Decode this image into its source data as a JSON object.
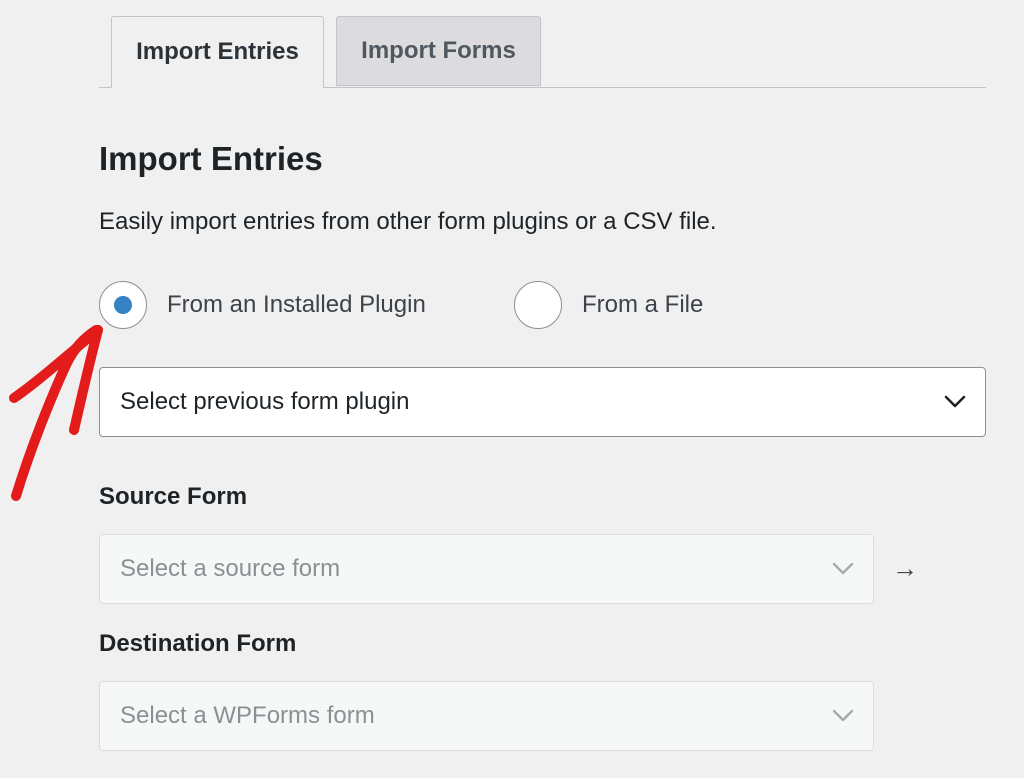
{
  "tabs": [
    {
      "label": "Import Entries",
      "active": true
    },
    {
      "label": "Import Forms",
      "active": false
    }
  ],
  "section": {
    "title": "Import Entries",
    "description": "Easily import entries from other form plugins or a CSV file."
  },
  "radios": [
    {
      "label": "From an Installed Plugin",
      "checked": true
    },
    {
      "label": "From a File",
      "checked": false
    }
  ],
  "plugin_select": {
    "value": "Select previous form plugin"
  },
  "source_form": {
    "label": "Source Form",
    "placeholder": "Select a source form"
  },
  "arrow": "→",
  "destination_form": {
    "label": "Destination Form",
    "placeholder": "Select a WPForms form"
  },
  "colors": {
    "accent": "#3582c4",
    "annotation": "#e31b1b",
    "background": "#f0f0f1"
  },
  "icons": [
    "chevron-down-icon",
    "arrow-right-icon",
    "annotation-arrow"
  ]
}
